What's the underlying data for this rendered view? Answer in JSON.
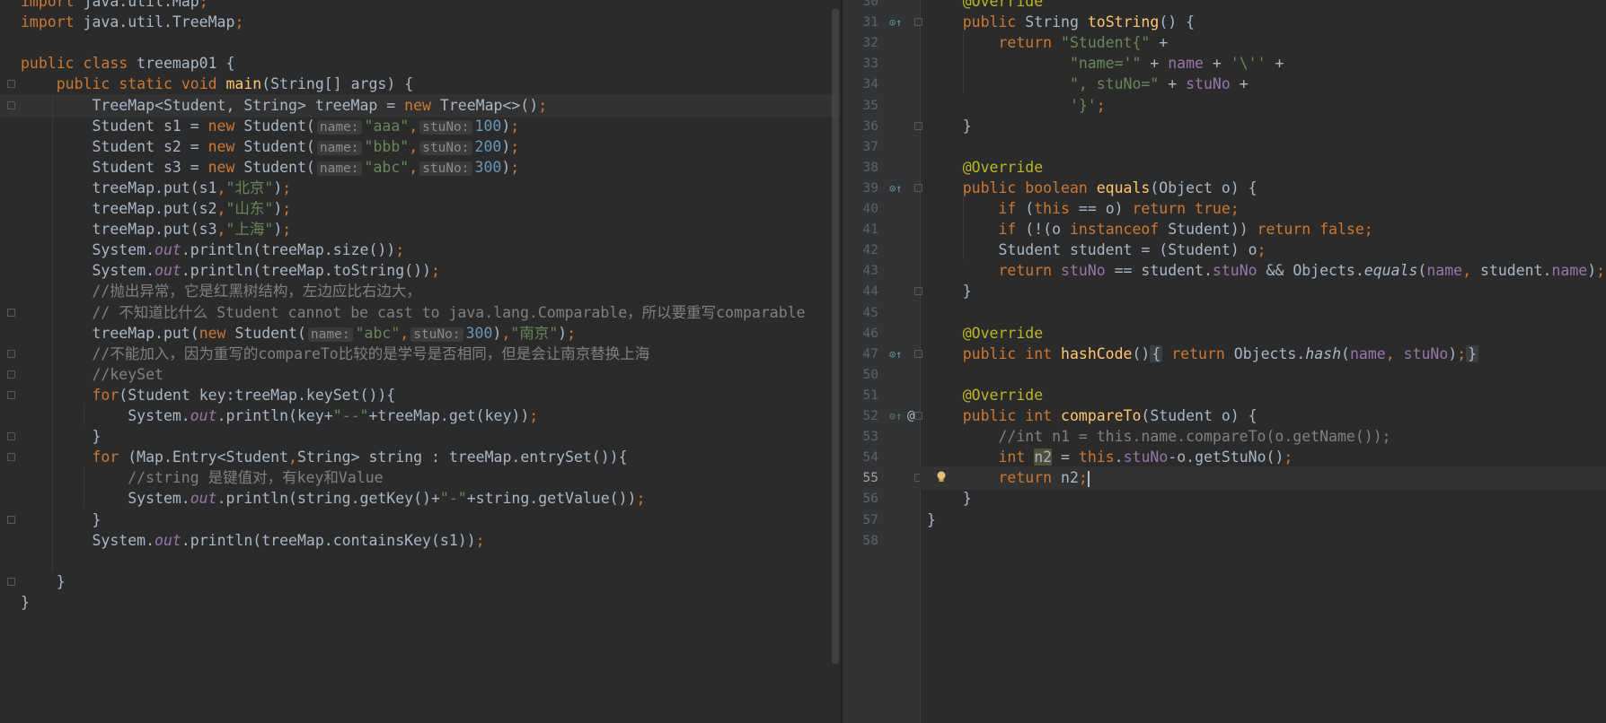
{
  "left_editor": {
    "lines": [
      {
        "tokens": [
          [
            "kw",
            "import "
          ],
          [
            "",
            "java.util.Map"
          ],
          [
            "kw",
            ";"
          ]
        ]
      },
      {
        "tokens": [
          [
            "kw",
            "import "
          ],
          [
            "",
            "java.util.TreeMap"
          ],
          [
            "kw",
            ";"
          ]
        ]
      },
      {
        "tokens": []
      },
      {
        "tokens": [
          [
            "kw",
            "public class "
          ],
          [
            "",
            "treemap01 {"
          ]
        ]
      },
      {
        "tokens": [
          [
            "",
            "    "
          ],
          [
            "kw",
            "public static void "
          ],
          [
            "fn",
            "main"
          ],
          [
            "",
            "(String[] args) {"
          ]
        ]
      },
      {
        "tokens": [
          [
            "",
            "        TreeMap<Student, String> treeMap = "
          ],
          [
            "kw",
            "new "
          ],
          [
            "",
            "TreeMap<>()"
          ],
          [
            "kw",
            ";"
          ]
        ],
        "current": true
      },
      {
        "tokens": [
          [
            "",
            "        Student s1 = "
          ],
          [
            "kw",
            "new "
          ],
          [
            "",
            "Student("
          ],
          [
            "hint",
            "name:"
          ],
          [
            "str",
            "\"aaa\""
          ],
          [
            "kw",
            ","
          ],
          [
            "hint",
            "stuNo:"
          ],
          [
            "num",
            "100"
          ],
          [
            "",
            ")"
          ],
          [
            "kw",
            ";"
          ]
        ]
      },
      {
        "tokens": [
          [
            "",
            "        Student s2 = "
          ],
          [
            "kw",
            "new "
          ],
          [
            "",
            "Student("
          ],
          [
            "hint",
            "name:"
          ],
          [
            "str",
            "\"bbb\""
          ],
          [
            "kw",
            ","
          ],
          [
            "hint",
            "stuNo:"
          ],
          [
            "num",
            "200"
          ],
          [
            "",
            ")"
          ],
          [
            "kw",
            ";"
          ]
        ]
      },
      {
        "tokens": [
          [
            "",
            "        Student s3 = "
          ],
          [
            "kw",
            "new "
          ],
          [
            "",
            "Student("
          ],
          [
            "hint",
            "name:"
          ],
          [
            "str",
            "\"abc\""
          ],
          [
            "kw",
            ","
          ],
          [
            "hint",
            "stuNo:"
          ],
          [
            "num",
            "300"
          ],
          [
            "",
            ")"
          ],
          [
            "kw",
            ";"
          ]
        ]
      },
      {
        "tokens": [
          [
            "",
            "        treeMap.put(s1"
          ],
          [
            "kw",
            ","
          ],
          [
            "str",
            "\"北京\""
          ],
          [
            "",
            ")"
          ],
          [
            "kw",
            ";"
          ]
        ]
      },
      {
        "tokens": [
          [
            "",
            "        treeMap.put(s2"
          ],
          [
            "kw",
            ","
          ],
          [
            "str",
            "\"山东\""
          ],
          [
            "",
            ")"
          ],
          [
            "kw",
            ";"
          ]
        ]
      },
      {
        "tokens": [
          [
            "",
            "        treeMap.put(s3"
          ],
          [
            "kw",
            ","
          ],
          [
            "str",
            "\"上海\""
          ],
          [
            "",
            ")"
          ],
          [
            "kw",
            ";"
          ]
        ]
      },
      {
        "tokens": [
          [
            "",
            "        System."
          ],
          [
            "st",
            "out"
          ],
          [
            "",
            ".println(treeMap.size())"
          ],
          [
            "kw",
            ";"
          ]
        ]
      },
      {
        "tokens": [
          [
            "",
            "        System."
          ],
          [
            "st",
            "out"
          ],
          [
            "",
            ".println(treeMap.toString())"
          ],
          [
            "kw",
            ";"
          ]
        ]
      },
      {
        "tokens": [
          [
            "cmt",
            "        //抛出异常，它是红黑树结构，左边应比右边大，"
          ]
        ]
      },
      {
        "tokens": [
          [
            "cmt",
            "        // 不知道比什么 Student cannot be cast to java.lang.Comparable，所以要重写comparable"
          ]
        ]
      },
      {
        "tokens": [
          [
            "",
            "        treeMap.put("
          ],
          [
            "kw",
            "new "
          ],
          [
            "",
            "Student("
          ],
          [
            "hint",
            "name:"
          ],
          [
            "str",
            "\"abc\""
          ],
          [
            "kw",
            ","
          ],
          [
            "hint",
            "stuNo:"
          ],
          [
            "num",
            "300"
          ],
          [
            "",
            ")"
          ],
          [
            "kw",
            ","
          ],
          [
            "str",
            "\"南京\""
          ],
          [
            "",
            ")"
          ],
          [
            "kw",
            ";"
          ]
        ]
      },
      {
        "tokens": [
          [
            "cmt",
            "        //不能加入，因为重写的compareTo比较的是学号是否相同，但是会让南京替换上海"
          ]
        ]
      },
      {
        "tokens": [
          [
            "cmt",
            "        //keySet"
          ]
        ]
      },
      {
        "tokens": [
          [
            "",
            "        "
          ],
          [
            "kw",
            "for"
          ],
          [
            "",
            "(Student key:treeMap.keySet()){"
          ]
        ]
      },
      {
        "tokens": [
          [
            "",
            "            System."
          ],
          [
            "st",
            "out"
          ],
          [
            "",
            ".println(key+"
          ],
          [
            "str",
            "\"--\""
          ],
          [
            "",
            "+treeMap.get(key))"
          ],
          [
            "kw",
            ";"
          ]
        ]
      },
      {
        "tokens": [
          [
            "",
            "        }"
          ]
        ]
      },
      {
        "tokens": [
          [
            "",
            "        "
          ],
          [
            "kw",
            "for "
          ],
          [
            "",
            "(Map.Entry<Student"
          ],
          [
            "kw",
            ","
          ],
          [
            "",
            "String> string : treeMap.entrySet()){"
          ]
        ]
      },
      {
        "tokens": [
          [
            "cmt",
            "            //string 是键值对，有key和Value"
          ]
        ]
      },
      {
        "tokens": [
          [
            "",
            "            System."
          ],
          [
            "st",
            "out"
          ],
          [
            "",
            ".println(string.getKey()+"
          ],
          [
            "str",
            "\"-\""
          ],
          [
            "",
            "+string.getValue())"
          ],
          [
            "kw",
            ";"
          ]
        ]
      },
      {
        "tokens": [
          [
            "",
            "        }"
          ]
        ]
      },
      {
        "tokens": [
          [
            "",
            "        System."
          ],
          [
            "st",
            "out"
          ],
          [
            "",
            ".println(treeMap.containsKey(s1))"
          ],
          [
            "kw",
            ";"
          ]
        ]
      },
      {
        "tokens": []
      },
      {
        "tokens": [
          [
            "",
            "    }"
          ]
        ]
      },
      {
        "tokens": [
          [
            "",
            "}"
          ]
        ]
      }
    ]
  },
  "right_editor": {
    "lines": [
      {
        "num": "30",
        "tokens": [
          [
            "ann",
            "    @Override"
          ]
        ]
      },
      {
        "num": "31",
        "icon": "override-icon",
        "tokens": [
          [
            "kw",
            "    public "
          ],
          [
            "",
            "String "
          ],
          [
            "fn",
            "toString"
          ],
          [
            "",
            "() {"
          ]
        ]
      },
      {
        "num": "32",
        "tokens": [
          [
            "kw",
            "        return "
          ],
          [
            "str",
            "\"Student{\" "
          ],
          [
            "",
            "+"
          ]
        ]
      },
      {
        "num": "33",
        "tokens": [
          [
            "str",
            "                \"name='\" "
          ],
          [
            "",
            "+ "
          ],
          [
            "fld",
            "name "
          ],
          [
            "",
            "+ "
          ],
          [
            "str",
            "'\\'' "
          ],
          [
            "",
            "+"
          ]
        ]
      },
      {
        "num": "34",
        "tokens": [
          [
            "str",
            "                \", stuNo=\" "
          ],
          [
            "",
            "+ "
          ],
          [
            "fld",
            "stuNo "
          ],
          [
            "",
            "+"
          ]
        ]
      },
      {
        "num": "35",
        "tokens": [
          [
            "str",
            "                '}'"
          ],
          [
            "kw",
            ";"
          ]
        ]
      },
      {
        "num": "36",
        "tokens": [
          [
            "",
            "    }"
          ]
        ]
      },
      {
        "num": "37",
        "tokens": []
      },
      {
        "num": "38",
        "tokens": [
          [
            "ann",
            "    @Override"
          ]
        ]
      },
      {
        "num": "39",
        "icon": "override-icon",
        "tokens": [
          [
            "kw",
            "    public boolean "
          ],
          [
            "fn",
            "equals"
          ],
          [
            "",
            "(Object o) {"
          ]
        ]
      },
      {
        "num": "40",
        "tokens": [
          [
            "kw",
            "        if "
          ],
          [
            "",
            "("
          ],
          [
            "kw",
            "this "
          ],
          [
            "",
            "== o) "
          ],
          [
            "kw",
            "return true;"
          ]
        ]
      },
      {
        "num": "41",
        "tokens": [
          [
            "kw",
            "        if "
          ],
          [
            "",
            "(!(o "
          ],
          [
            "kw",
            "instanceof "
          ],
          [
            "",
            "Student)) "
          ],
          [
            "kw",
            "return false;"
          ]
        ]
      },
      {
        "num": "42",
        "tokens": [
          [
            "",
            "        Student student = (Student) o"
          ],
          [
            "kw",
            ";"
          ]
        ]
      },
      {
        "num": "43",
        "tokens": [
          [
            "kw",
            "        return "
          ],
          [
            "fld",
            "stuNo "
          ],
          [
            "",
            "== student."
          ],
          [
            "fld",
            "stuNo "
          ],
          [
            "",
            "&& Objects."
          ],
          [
            "it",
            "equals"
          ],
          [
            "",
            "("
          ],
          [
            "fld",
            "name"
          ],
          [
            "kw",
            ", "
          ],
          [
            "",
            "student."
          ],
          [
            "fld",
            "name"
          ],
          [
            "",
            ")"
          ],
          [
            "kw",
            ";"
          ]
        ]
      },
      {
        "num": "44",
        "tokens": [
          [
            "",
            "    }"
          ]
        ]
      },
      {
        "num": "45",
        "tokens": []
      },
      {
        "num": "46",
        "tokens": [
          [
            "ann",
            "    @Override"
          ]
        ]
      },
      {
        "num": "47",
        "icon": "override-icon",
        "tokens": [
          [
            "kw",
            "    public int "
          ],
          [
            "fn",
            "hashCode"
          ],
          [
            "",
            "()"
          ],
          [
            "fbox",
            "{"
          ],
          [
            "kw",
            " return "
          ],
          [
            "",
            "Objects."
          ],
          [
            "it",
            "hash"
          ],
          [
            "",
            "("
          ],
          [
            "fld",
            "name"
          ],
          [
            "kw",
            ", "
          ],
          [
            "fld",
            "stuNo"
          ],
          [
            "",
            ")"
          ],
          [
            "kw",
            ";"
          ],
          [
            "fbox",
            "}"
          ]
        ]
      },
      {
        "num": "50",
        "tokens": []
      },
      {
        "num": "51",
        "tokens": [
          [
            "ann",
            "    @Override"
          ]
        ]
      },
      {
        "num": "52",
        "icon": "implement-icon",
        "at": "@",
        "tokens": [
          [
            "kw",
            "    public int "
          ],
          [
            "fn",
            "compareTo"
          ],
          [
            "",
            "(Student o) {"
          ]
        ]
      },
      {
        "num": "53",
        "tokens": [
          [
            "cmt",
            "        //int n1 = this.name.compareTo(o.getName());"
          ]
        ]
      },
      {
        "num": "54",
        "tokens": [
          [
            "kw",
            "        int "
          ],
          [
            "hl",
            "n2"
          ],
          [
            "",
            " = "
          ],
          [
            "kw",
            "this"
          ],
          [
            "",
            "."
          ],
          [
            "fld",
            "stuNo"
          ],
          [
            "",
            "-o.getStuNo()"
          ],
          [
            "kw",
            ";"
          ]
        ]
      },
      {
        "num": "55",
        "current": true,
        "bulb": true,
        "tokens": [
          [
            "kw",
            "        return "
          ],
          [
            "",
            "n2"
          ],
          [
            "kw",
            ";"
          ],
          [
            "caret",
            ""
          ]
        ]
      },
      {
        "num": "56",
        "tokens": [
          [
            "",
            "    }"
          ]
        ]
      },
      {
        "num": "57",
        "tokens": [
          [
            "",
            "}"
          ]
        ]
      },
      {
        "num": "58",
        "tokens": []
      }
    ]
  },
  "colors": {
    "background": "#2b2b2b",
    "keyword": "#cc7832",
    "string": "#6a8759",
    "number": "#6897bb",
    "comment": "#808080",
    "annotation": "#bbb529",
    "field": "#9876aa",
    "method": "#ffc66d"
  },
  "icons": {
    "override": "override-icon",
    "implement": "implement-icon",
    "bulb": "lightbulb-icon"
  }
}
